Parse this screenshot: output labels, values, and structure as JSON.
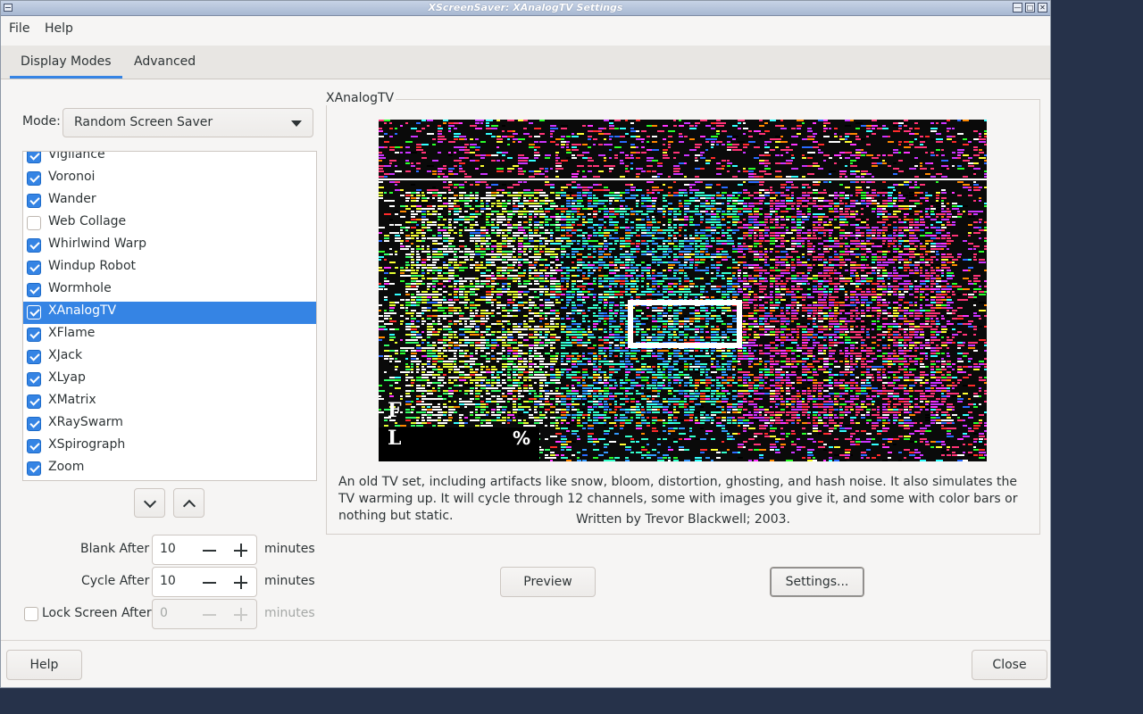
{
  "window": {
    "title": "XScreenSaver: XAnalogTV Settings"
  },
  "menubar": {
    "items": [
      "File",
      "Help"
    ]
  },
  "tabs": [
    {
      "label": "Display Modes",
      "active": true
    },
    {
      "label": "Advanced",
      "active": false
    }
  ],
  "mode": {
    "label": "Mode:",
    "value": "Random Screen Saver"
  },
  "hacks": [
    {
      "name": "Vigilance",
      "checked": true,
      "selected": false
    },
    {
      "name": "Voronoi",
      "checked": true,
      "selected": false
    },
    {
      "name": "Wander",
      "checked": true,
      "selected": false
    },
    {
      "name": "Web Collage",
      "checked": false,
      "selected": false
    },
    {
      "name": "Whirlwind Warp",
      "checked": true,
      "selected": false
    },
    {
      "name": "Windup Robot",
      "checked": true,
      "selected": false
    },
    {
      "name": "Wormhole",
      "checked": true,
      "selected": false
    },
    {
      "name": "XAnalogTV",
      "checked": true,
      "selected": true
    },
    {
      "name": "XFlame",
      "checked": true,
      "selected": false
    },
    {
      "name": "XJack",
      "checked": true,
      "selected": false
    },
    {
      "name": "XLyap",
      "checked": true,
      "selected": false
    },
    {
      "name": "XMatrix",
      "checked": true,
      "selected": false
    },
    {
      "name": "XRaySwarm",
      "checked": true,
      "selected": false
    },
    {
      "name": "XSpirograph",
      "checked": true,
      "selected": false
    },
    {
      "name": "Zoom",
      "checked": true,
      "selected": false
    }
  ],
  "timing": {
    "blank": {
      "label": "Blank After",
      "value": "10",
      "unit": "minutes"
    },
    "cycle": {
      "label": "Cycle After",
      "value": "10",
      "unit": "minutes"
    },
    "lock": {
      "label": "Lock Screen After",
      "value": "0",
      "unit": "minutes",
      "checked": false
    }
  },
  "preview": {
    "frame_title": "XAnalogTV",
    "overlay_chars": [
      "F",
      "L",
      "%"
    ],
    "description": "An old TV set, including artifacts like snow, bloom, distortion, ghosting, and hash noise. It also simulates the TV warming up. It will cycle through 12 channels, some with images you give it, and some with color bars or nothing but static.",
    "credit": "Written by Trevor Blackwell; 2003."
  },
  "buttons": {
    "preview": "Preview",
    "settings": "Settings...",
    "help": "Help",
    "close": "Close"
  },
  "colors": {
    "accent": "#3584e4",
    "desktop": "#26324a"
  }
}
